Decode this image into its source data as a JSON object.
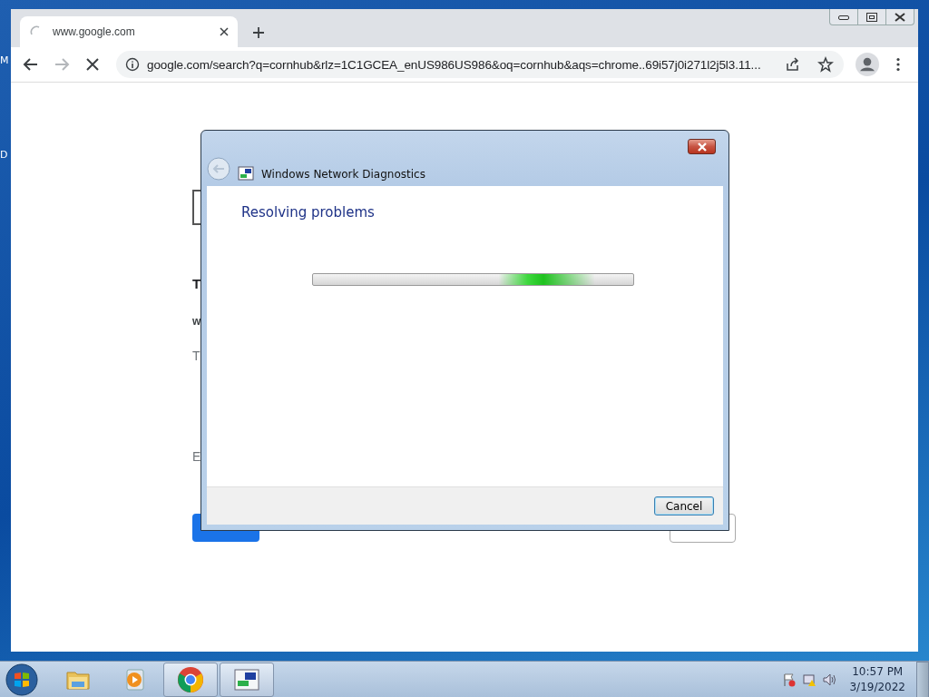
{
  "desktop": {
    "edge_labels": [
      "M",
      "D"
    ]
  },
  "browser": {
    "tabs": [
      {
        "title": "www.google.com",
        "selected": true,
        "loading": true
      }
    ],
    "address": "google.com/search?q=cornhub&rlz=1C1GCEA_enUS986US986&oq=cornhub&aqs=chrome..69i57j0i271l2j5l3.11...",
    "loading": true,
    "page": {
      "texts": [
        {
          "kind": "heading",
          "text": "T"
        },
        {
          "kind": "bold",
          "text": "w"
        },
        {
          "kind": "muted",
          "text": "T"
        },
        {
          "kind": "muted",
          "text": "E"
        }
      ],
      "buttons": [
        {
          "kind": "primary"
        },
        {
          "kind": "outlined"
        }
      ]
    }
  },
  "dialog": {
    "title": "Windows Network Diagnostics",
    "heading": "Resolving problems",
    "progress": {
      "indeterminate": true
    },
    "buttons": [
      {
        "label": "Cancel",
        "focused": true
      }
    ]
  },
  "taskbar": {
    "items": [
      {
        "kind": "folder",
        "running": false
      },
      {
        "kind": "media",
        "running": false
      },
      {
        "kind": "chrome",
        "running": true
      },
      {
        "kind": "network",
        "running": true
      }
    ],
    "tray": [
      {
        "kind": "flag-error"
      },
      {
        "kind": "network-warning"
      },
      {
        "kind": "speaker"
      }
    ],
    "clock": {
      "time": "10:57 PM",
      "date": "3/19/2022"
    }
  }
}
